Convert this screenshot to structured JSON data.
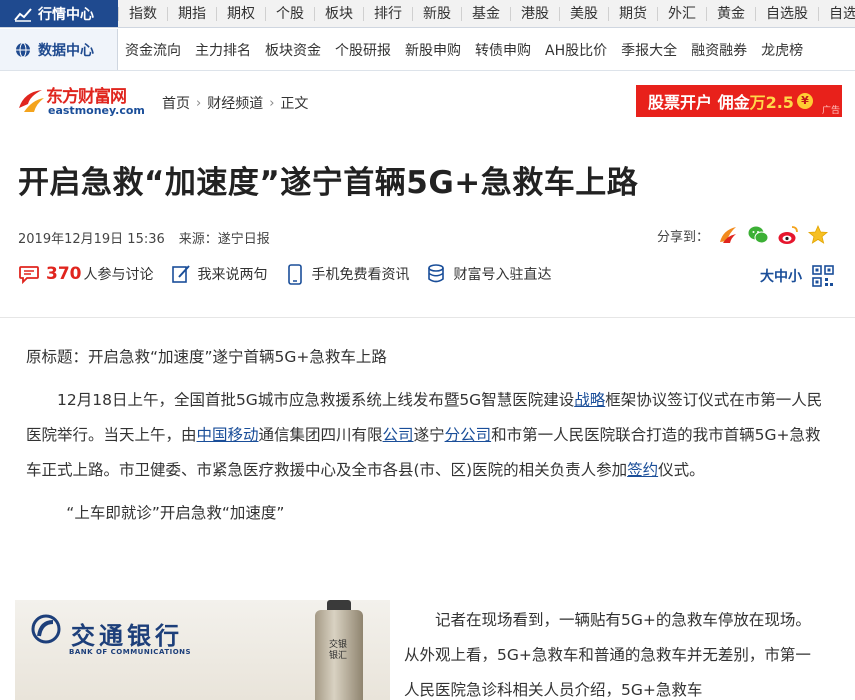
{
  "top_nav": {
    "title": "行情中心",
    "items": [
      "指数",
      "期指",
      "期权",
      "个股",
      "板块",
      "排行",
      "新股",
      "基金",
      "港股",
      "美股",
      "期货",
      "外汇",
      "黄金",
      "自选股",
      "自选"
    ]
  },
  "data_nav": {
    "title": "数据中心",
    "items": [
      "资金流向",
      "主力排名",
      "板块资金",
      "个股研报",
      "新股申购",
      "转债申购",
      "AH股比价",
      "季报大全",
      "融资融券",
      "龙虎榜"
    ]
  },
  "brand": {
    "logo_cn": "东方财富网",
    "logo_en": "eastmoney.com",
    "breadcrumb": [
      "首页",
      "财经频道",
      "正文"
    ],
    "ad": {
      "text1": "股票开户 佣金",
      "highlight": "万2.5",
      "coin": "¥",
      "tag": "广告"
    }
  },
  "article": {
    "title": "开启急救“加速度”遂宁首辆5G+急救车上路",
    "date": "2019年12月19日 15:36",
    "source": "来源：遂宁日报",
    "share_label": "分享到：",
    "comment_count": "370",
    "comment_label": "人参与讨论",
    "tools": [
      "我来说两句",
      "手机免费看资讯",
      "财富号入驻直达"
    ],
    "font_size_label": "大中小",
    "original_title": "原标题：开启急救“加速度”遂宁首辆5G+急救车上路",
    "p1": {
      "a": "12月18日上午，全国首批5G城市应急救援系统上线发布暨5G智慧医院建设",
      "link1": "战略",
      "b": "框架协议签订仪式在市第一人民医院举行。当天上午，由",
      "link2": "中国移动",
      "c": "通信集团四川有限",
      "link3": "公司",
      "d": "遂宁",
      "link4": "分公司",
      "e": "和市第一人民医院联合打造的我市首辆5G+急救车正式上路。市卫健委、市紧急医疗救援中心及全市各县(市、区)医院的相关负责人参加",
      "link5": "签约",
      "f": "仪式。"
    },
    "subheading": "“上车即就诊”开启急救“加速度”",
    "p2": "记者在现场看到，一辆贴有5G+的急救车停放在现场。从外观上看，5G+急救车和普通的急救车并无差别，市第一人民医院急诊科相关人员介绍，5G+急救车"
  },
  "photo": {
    "bank_cn": "交通银行",
    "bank_en": "BANK OF COMMUNICATIONS",
    "bottle_label": "交银银汇"
  },
  "colors": {
    "brand_red": "#e0251e",
    "link_blue": "#1a4e99",
    "nav_blue": "#1f4a8f"
  }
}
